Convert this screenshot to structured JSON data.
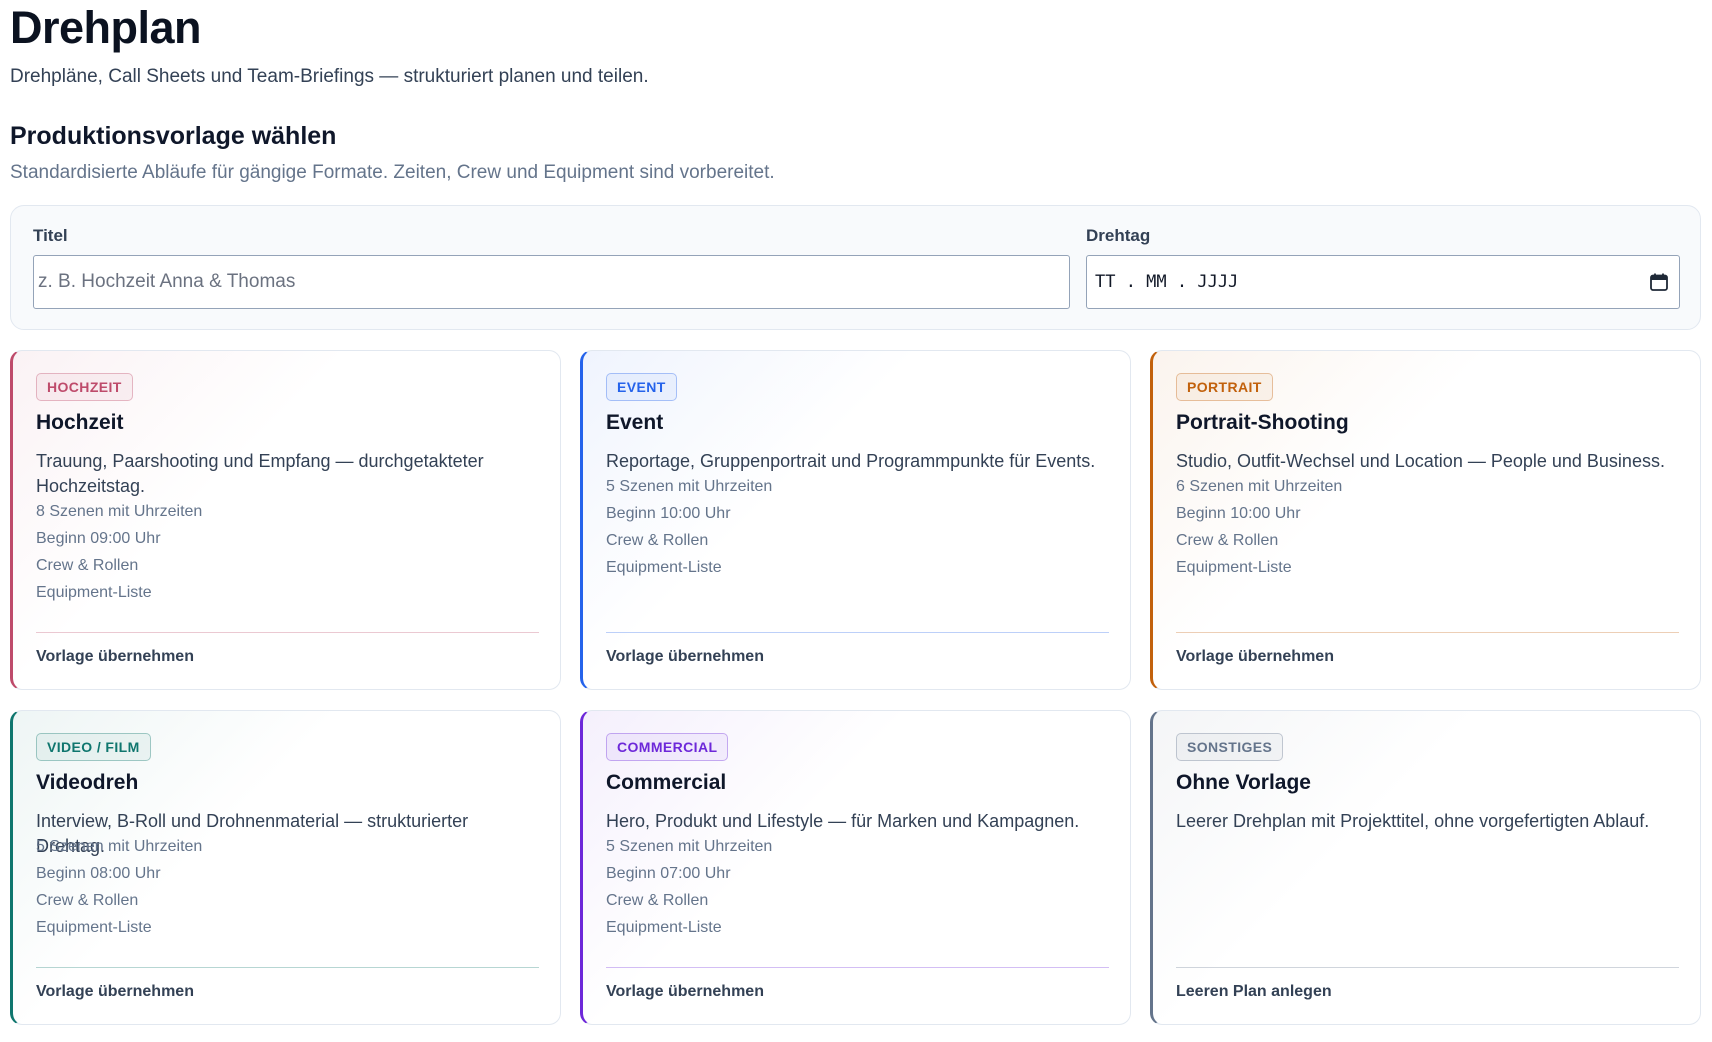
{
  "header": {
    "title": "Drehplan",
    "subtitle": "Drehpläne, Call Sheets und Team-Briefings — strukturiert planen und teilen."
  },
  "section": {
    "title": "Produktionsvorlage wählen",
    "subtitle": "Standardisierte Abläufe für gängige Formate. Zeiten, Crew und Equipment sind vorbereitet."
  },
  "form": {
    "title_label": "Titel",
    "title_placeholder": "z. B. Hochzeit Anna & Thomas",
    "title_value": "",
    "date_label": "Drehtag",
    "date_placeholder": "TT.MM.JJJJ",
    "date_icon": "calendar-icon"
  },
  "templates": [
    {
      "badge": "HOCHZEIT",
      "name": "Hochzeit",
      "description": "Trauung, Paarshooting und Empfang — durchgetakteter Hochzeitstag.",
      "features": [
        "8 Szenen mit Uhrzeiten",
        "Beginn 09:00 Uhr",
        "Crew & Rollen",
        "Equipment-Liste"
      ],
      "action": "Vorlage übernehmen",
      "accent": "#be4b6b"
    },
    {
      "badge": "EVENT",
      "name": "Event",
      "description": "Reportage, Gruppenportrait und Programmpunkte für Events.",
      "features": [
        "5 Szenen mit Uhrzeiten",
        "Beginn 10:00 Uhr",
        "Crew & Rollen",
        "Equipment-Liste"
      ],
      "action": "Vorlage übernehmen",
      "accent": "#2563eb"
    },
    {
      "badge": "PORTRAIT",
      "name": "Portrait-Shooting",
      "description": "Studio, Outfit-Wechsel und Location — People und Business.",
      "features": [
        "6 Szenen mit Uhrzeiten",
        "Beginn 10:00 Uhr",
        "Crew & Rollen",
        "Equipment-Liste"
      ],
      "action": "Vorlage übernehmen",
      "accent": "#c2610c"
    },
    {
      "badge": "VIDEO / FILM",
      "name": "Videodreh",
      "description": "Interview, B-Roll und Drohnenmaterial — strukturierter Drehtag.",
      "features": [
        "5 Szenen mit Uhrzeiten",
        "Beginn 08:00 Uhr",
        "Crew & Rollen",
        "Equipment-Liste"
      ],
      "action": "Vorlage übernehmen",
      "accent": "#0f766e"
    },
    {
      "badge": "COMMERCIAL",
      "name": "Commercial",
      "description": "Hero, Produkt und Lifestyle — für Marken und Kampagnen.",
      "features": [
        "5 Szenen mit Uhrzeiten",
        "Beginn 07:00 Uhr",
        "Crew & Rollen",
        "Equipment-Liste"
      ],
      "action": "Vorlage übernehmen",
      "accent": "#6d28d9"
    },
    {
      "badge": "SONSTIGES",
      "name": "Ohne Vorlage",
      "description": "Leerer Drehplan mit Projekttitel, ohne vorgefertigten Ablauf.",
      "features": [],
      "action": "Leeren Plan anlegen",
      "accent": "#64748b"
    }
  ]
}
